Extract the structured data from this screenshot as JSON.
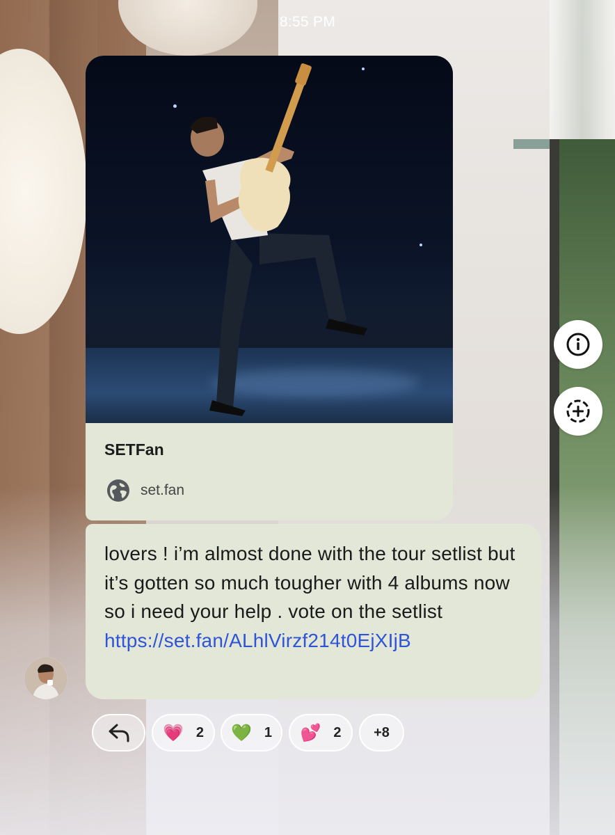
{
  "status_bar": {
    "time": "8:55 PM"
  },
  "link_card": {
    "title": "SETFan",
    "domain": "set.fan",
    "icon": "globe-icon"
  },
  "message": {
    "text": "lovers ! i’m almost done with the tour setlist but it’s gotten so much tougher with 4 albums now so i need your help . vote on the setlist ",
    "link": "https://set.fan/ALhlVirzf214t0EjXIjB"
  },
  "side_actions": [
    {
      "icon": "info-icon"
    },
    {
      "icon": "add-circle-icon"
    }
  ],
  "reactions": {
    "reply_icon": "reply-arrow-icon",
    "items": [
      {
        "emoji": "💗",
        "count": "2",
        "color": "#e0559a"
      },
      {
        "emoji": "💚",
        "count": "1",
        "color": "#3fae43"
      },
      {
        "emoji": "💕",
        "count": "2",
        "color": "#ef6fb0"
      }
    ],
    "more": "+8"
  }
}
